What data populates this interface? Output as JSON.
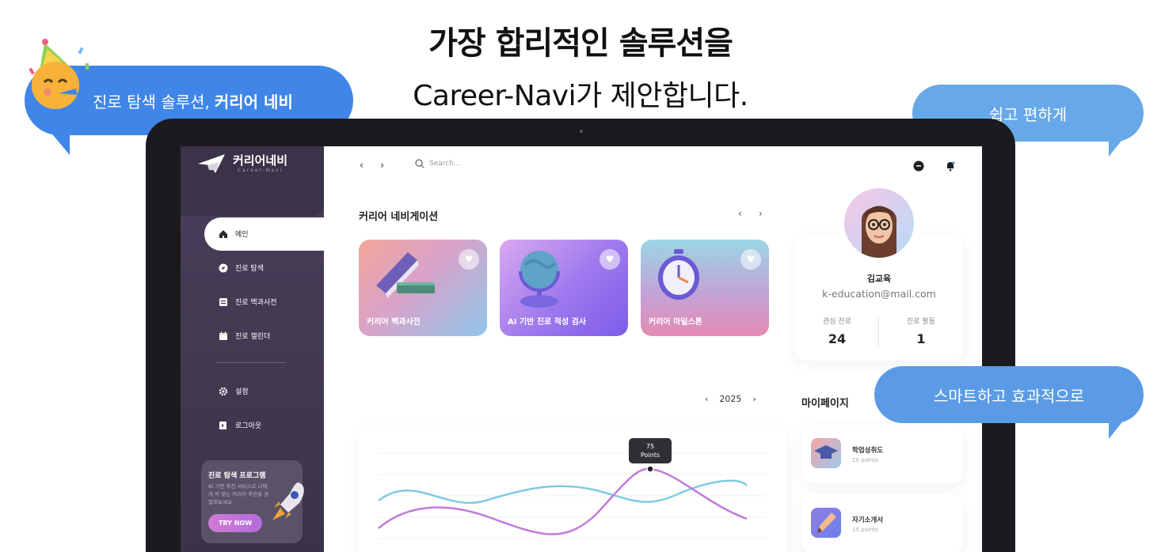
{
  "hero": {
    "title": "가장 합리적인 솔루션을",
    "subtitle": "Career-Navi가 제안합니다."
  },
  "bubbles": {
    "left_plain": "진로 탐색 솔루션,",
    "left_bold": "커리어 네비",
    "right_top": "쉽고 편하게",
    "right_bottom": "스마트하고 효과적으로"
  },
  "sidebar": {
    "logo_title": "커리어네비",
    "logo_sub": "Career-Navi",
    "items": [
      {
        "label": "메인",
        "icon": "home-icon",
        "active": true
      },
      {
        "label": "진로 탐색",
        "icon": "compass-icon"
      },
      {
        "label": "진로 백과사전",
        "icon": "book-icon"
      },
      {
        "label": "진로 캘린더",
        "icon": "calendar-icon"
      },
      {
        "label": "설정",
        "icon": "gear-icon"
      },
      {
        "label": "로그아웃",
        "icon": "logout-icon"
      }
    ],
    "promo": {
      "title": "진로 탐색 프로그램",
      "text": "AI 기반 추천 서비스로 나에게 딱 맞는 커리어 추천을 경험해보세요",
      "button": "TRY NOW"
    }
  },
  "topbar": {
    "search_placeholder": "Search..."
  },
  "navigation": {
    "title": "커리어 네비게이션",
    "cards": [
      {
        "label": "커리어 백과사전"
      },
      {
        "label": "AI 기반 진로 적성 검사"
      },
      {
        "label": "커리어 마일스톤"
      }
    ]
  },
  "profile": {
    "name": "김교육",
    "email": "k-education@mail.com",
    "stat1_label": "관심 진로",
    "stat1_value": "24",
    "stat2_label": "진로 활동",
    "stat2_value": "1"
  },
  "chart": {
    "year": "2025",
    "tooltip_value": "75",
    "tooltip_unit": "Points",
    "colors": {
      "series_a": "#c07ad8",
      "series_b": "#7fcbe2"
    }
  },
  "mypage": {
    "title": "마이페이지",
    "items": [
      {
        "name": "학업성취도",
        "points": "20 points"
      },
      {
        "name": "자기소개서",
        "points": "15 points"
      }
    ]
  }
}
